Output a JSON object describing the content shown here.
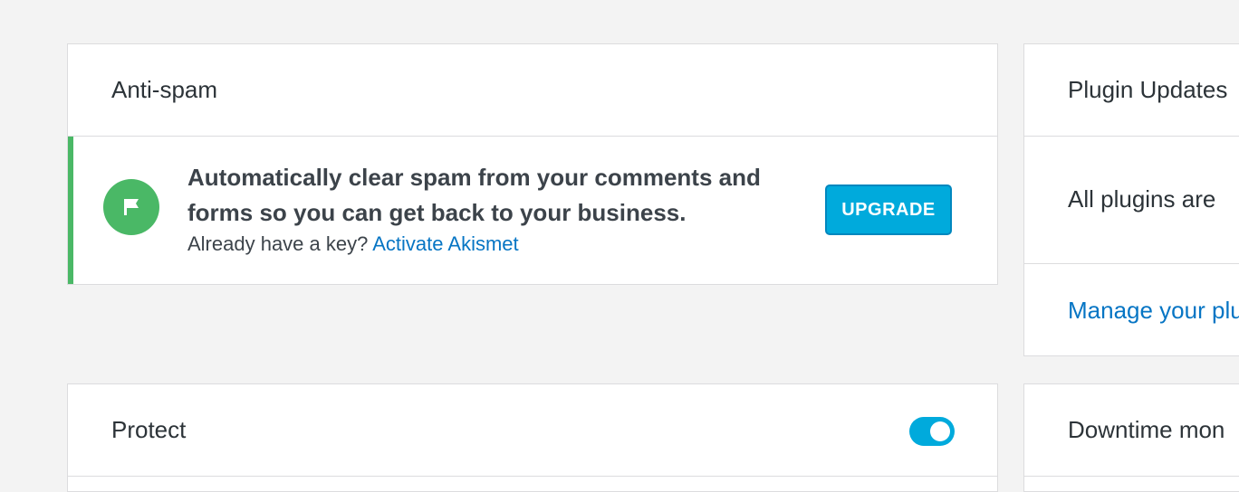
{
  "antispam": {
    "title": "Anti-spam",
    "message": "Automatically clear spam from your comments and forms so you can get back to your business.",
    "sub_prefix": "Already have a key? ",
    "activate_link": "Activate Akismet",
    "upgrade_label": "UPGRADE",
    "icon": "flag-icon"
  },
  "plugin_updates": {
    "title": "Plugin Updates",
    "status": "All plugins are",
    "manage_link": "Manage your plu"
  },
  "protect": {
    "title": "Protect",
    "toggle_on": true
  },
  "downtime": {
    "title": "Downtime mon"
  },
  "colors": {
    "accent_green": "#4ab866",
    "button_blue": "#00aadc",
    "link_blue": "#0675c4"
  }
}
